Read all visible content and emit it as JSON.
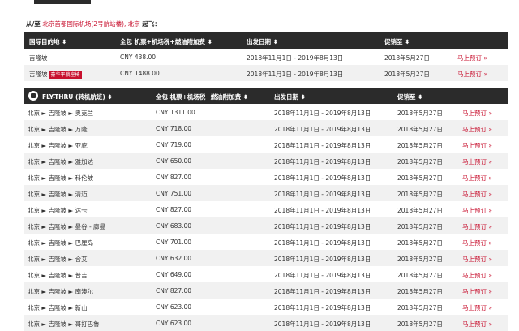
{
  "from_line": {
    "prefix": "从/至",
    "origin": "北京首都国际机场(2号航站楼), 北京",
    "suffix": "起飞："
  },
  "table1": {
    "headers": [
      "国际目的地 ⬍",
      "全包 机票+机场税+燃油附加费 ⬍",
      "出发日期 ⬍",
      "促销至 ⬍"
    ],
    "rows": [
      {
        "dest": "吉隆坡",
        "badge": "",
        "price": "CNY 438.00",
        "dates": "2018年11月1日 - 2019年8月13日",
        "until": "2018年5月27日",
        "book": "马上预订 »"
      },
      {
        "dest": "吉隆坡",
        "badge": "豪华平躺座椅",
        "price": "CNY 1488.00",
        "dates": "2018年11月1日 - 2019年8月13日",
        "until": "2018年5月27日",
        "book": "马上预订 »"
      }
    ]
  },
  "table2": {
    "headers": [
      "FLY-THRU (转机航班) ⬍",
      "全包 机票+机场税+燃油附加费 ⬍",
      "出发日期 ⬍",
      "促销至 ⬍"
    ],
    "rows": [
      {
        "route": "北京 ► 吉隆坡 ► 奥克兰",
        "price": "CNY 1311.00",
        "dates": "2018年11月1日 - 2019年8月13日",
        "until": "2018年5月27日",
        "book": "马上预订 »"
      },
      {
        "route": "北京 ► 吉隆坡 ► 万隆",
        "price": "CNY 718.00",
        "dates": "2018年11月1日 - 2019年8月13日",
        "until": "2018年5月27日",
        "book": "马上预订 »"
      },
      {
        "route": "北京 ► 吉隆坡 ► 亚庇",
        "price": "CNY 719.00",
        "dates": "2018年11月1日 - 2019年8月13日",
        "until": "2018年5月27日",
        "book": "马上预订 »"
      },
      {
        "route": "北京 ► 吉隆坡 ► 雅加达",
        "price": "CNY 650.00",
        "dates": "2018年11月1日 - 2019年8月13日",
        "until": "2018年5月27日",
        "book": "马上预订 »"
      },
      {
        "route": "北京 ► 吉隆坡 ► 科伦坡",
        "price": "CNY 827.00",
        "dates": "2018年11月1日 - 2019年8月13日",
        "until": "2018年5月27日",
        "book": "马上预订 »"
      },
      {
        "route": "北京 ► 吉隆坡 ► 清迈",
        "price": "CNY 751.00",
        "dates": "2018年11月1日 - 2019年8月13日",
        "until": "2018年5月27日",
        "book": "马上预订 »"
      },
      {
        "route": "北京 ► 吉隆坡 ► 达卡",
        "price": "CNY 827.00",
        "dates": "2018年11月1日 - 2019年8月13日",
        "until": "2018年5月27日",
        "book": "马上预订 »"
      },
      {
        "route": "北京 ► 吉隆坡 ► 曼谷 - 廊曼",
        "price": "CNY 683.00",
        "dates": "2018年11月1日 - 2019年8月13日",
        "until": "2018年5月27日",
        "book": "马上预订 »"
      },
      {
        "route": "北京 ► 吉隆坡 ► 巴厘岛",
        "price": "CNY 701.00",
        "dates": "2018年11月1日 - 2019年8月13日",
        "until": "2018年5月27日",
        "book": "马上预订 »"
      },
      {
        "route": "北京 ► 吉隆坡 ► 合艾",
        "price": "CNY 632.00",
        "dates": "2018年11月1日 - 2019年8月13日",
        "until": "2018年5月27日",
        "book": "马上预订 »"
      },
      {
        "route": "北京 ► 吉隆坡 ► 普吉",
        "price": "CNY 649.00",
        "dates": "2018年11月1日 - 2019年8月13日",
        "until": "2018年5月27日",
        "book": "马上预订 »"
      },
      {
        "route": "北京 ► 吉隆坡 ► 南澳尔",
        "price": "CNY 827.00",
        "dates": "2018年11月1日 - 2019年8月13日",
        "until": "2018年5月27日",
        "book": "马上预订 »"
      },
      {
        "route": "北京 ► 吉隆坡 ► 新山",
        "price": "CNY 623.00",
        "dates": "2018年11月1日 - 2019年8月13日",
        "until": "2018年5月27日",
        "book": "马上预订 »"
      },
      {
        "route": "北京 ► 吉隆坡 ► 哥打巴鲁",
        "price": "CNY 623.00",
        "dates": "2018年11月1日 - 2019年8月13日",
        "until": "2018年5月27日",
        "book": "马上预订 »"
      }
    ]
  }
}
